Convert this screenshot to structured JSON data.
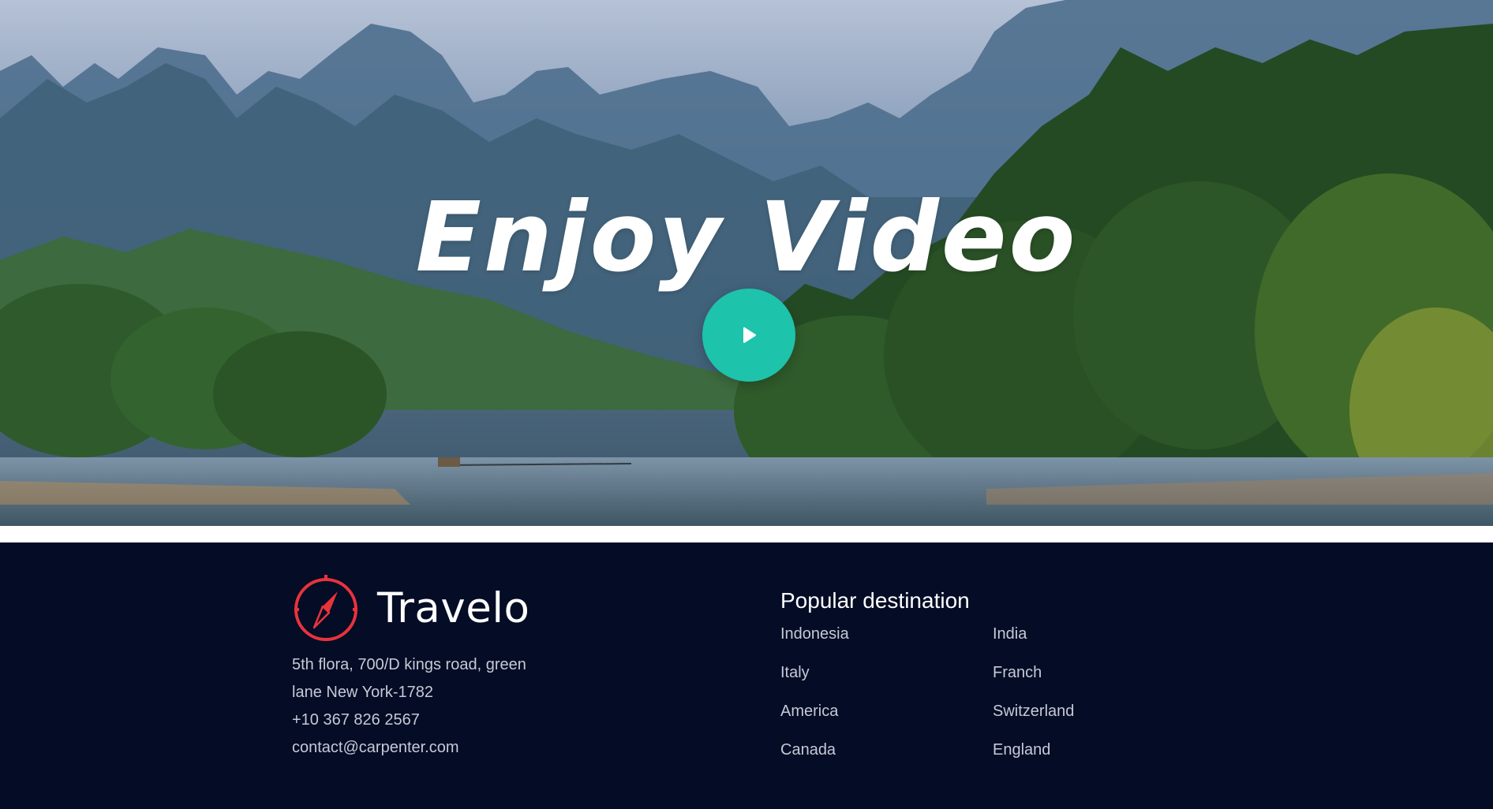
{
  "hero": {
    "title": "Enjoy Video",
    "play_icon": "play-icon",
    "accent_color": "#1ec3ab"
  },
  "footer": {
    "brand": {
      "name": "Travelo",
      "logo_icon": "compass-icon",
      "logo_color": "#e8333b"
    },
    "address": {
      "line1": "5th flora, 700/D kings road, green",
      "line2": "lane New York-1782",
      "phone": "+10 367 826 2567",
      "email": "contact@carpenter.com"
    },
    "popular": {
      "title": "Popular destination",
      "destinations": [
        "Indonesia",
        "India",
        "Italy",
        "Franch",
        "America",
        "Switzerland",
        "Canada",
        "England"
      ]
    },
    "background": "#040c26"
  }
}
